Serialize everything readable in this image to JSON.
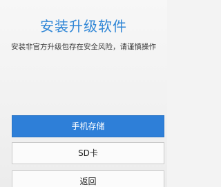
{
  "dialog": {
    "title": "安装升级软件",
    "warning": "安装非官方升级包存在安全风险，请谨慎操作",
    "buttons": {
      "phone_storage": "手机存储",
      "sd_card": "SD卡",
      "back": "返回"
    }
  },
  "colors": {
    "accent": "#2e7fd8",
    "title": "#2f86d6",
    "background": "#f3f3f3"
  }
}
